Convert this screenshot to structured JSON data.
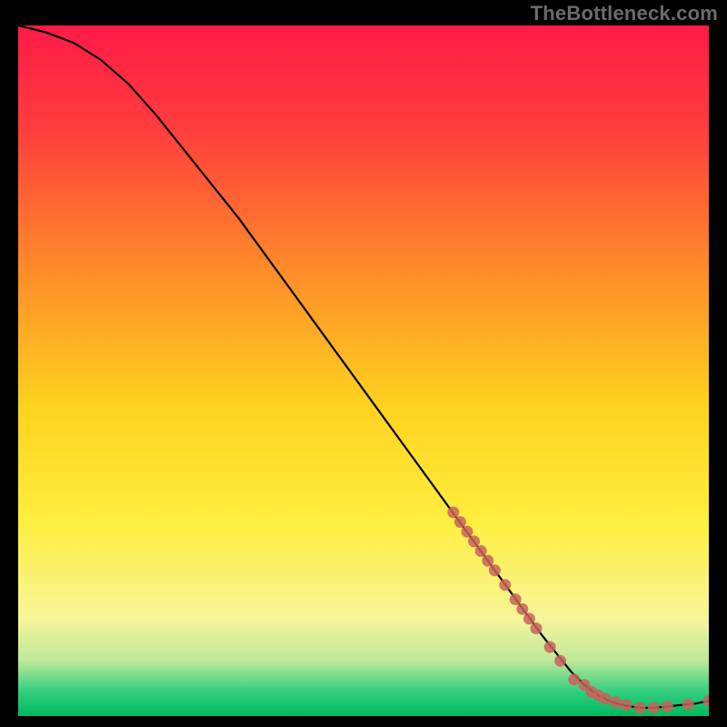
{
  "watermark": "TheBottleneck.com",
  "colors": {
    "background": "#000000",
    "gradient_top": "#ff1a47",
    "gradient_mid_upper": "#ff7a3a",
    "gradient_mid": "#ffd633",
    "gradient_lower": "#fff56b",
    "gradient_green_light": "#8fe27a",
    "gradient_green": "#00c46a",
    "curve": "#000000",
    "marker_fill": "#c9635c",
    "marker_stroke": "#c9635c"
  },
  "chart_data": {
    "type": "line",
    "title": "",
    "xlabel": "",
    "ylabel": "",
    "xlim": [
      0,
      100
    ],
    "ylim": [
      0,
      100
    ],
    "curve": {
      "x": [
        0,
        4,
        8,
        12,
        16,
        20,
        24,
        28,
        32,
        36,
        40,
        44,
        48,
        52,
        56,
        60,
        64,
        68,
        72,
        76,
        80,
        82,
        84,
        86,
        88,
        90,
        92,
        94,
        96,
        98,
        100
      ],
      "y": [
        100,
        99,
        97.5,
        95,
        91.5,
        87,
        82,
        77,
        72,
        66.5,
        61,
        55.5,
        50,
        44.5,
        39,
        33.5,
        28,
        22.5,
        17,
        11.5,
        6.5,
        4.5,
        3,
        2,
        1.5,
        1.2,
        1.2,
        1.4,
        1.6,
        1.8,
        2.2
      ]
    },
    "markers": [
      {
        "x": 63,
        "y": 29.5
      },
      {
        "x": 64,
        "y": 28.1
      },
      {
        "x": 65,
        "y": 26.7
      },
      {
        "x": 66,
        "y": 25.3
      },
      {
        "x": 67,
        "y": 23.9
      },
      {
        "x": 68,
        "y": 22.5
      },
      {
        "x": 69,
        "y": 21.1
      },
      {
        "x": 70.5,
        "y": 19.0
      },
      {
        "x": 72,
        "y": 16.9
      },
      {
        "x": 73,
        "y": 15.5
      },
      {
        "x": 74,
        "y": 14.1
      },
      {
        "x": 75,
        "y": 12.7
      },
      {
        "x": 77,
        "y": 10.0
      },
      {
        "x": 78.5,
        "y": 8.0
      },
      {
        "x": 80.5,
        "y": 5.3
      },
      {
        "x": 82,
        "y": 4.5
      },
      {
        "x": 83,
        "y": 3.5
      },
      {
        "x": 84,
        "y": 3.0
      },
      {
        "x": 85,
        "y": 2.5
      },
      {
        "x": 86.5,
        "y": 2.0
      },
      {
        "x": 88,
        "y": 1.6
      },
      {
        "x": 90,
        "y": 1.2
      },
      {
        "x": 92,
        "y": 1.2
      },
      {
        "x": 94,
        "y": 1.4
      },
      {
        "x": 97,
        "y": 1.7
      },
      {
        "x": 100,
        "y": 2.2
      }
    ],
    "gradient_stops": [
      {
        "offset": 0.0,
        "color": "#ff1a47"
      },
      {
        "offset": 0.15,
        "color": "#ff3d3d"
      },
      {
        "offset": 0.35,
        "color": "#ff8a2a"
      },
      {
        "offset": 0.55,
        "color": "#ffd21f"
      },
      {
        "offset": 0.72,
        "color": "#ffef3f"
      },
      {
        "offset": 0.86,
        "color": "#f6f59a"
      },
      {
        "offset": 0.92,
        "color": "#bde89a"
      },
      {
        "offset": 0.965,
        "color": "#31cf7e"
      },
      {
        "offset": 1.0,
        "color": "#00b85f"
      }
    ]
  }
}
